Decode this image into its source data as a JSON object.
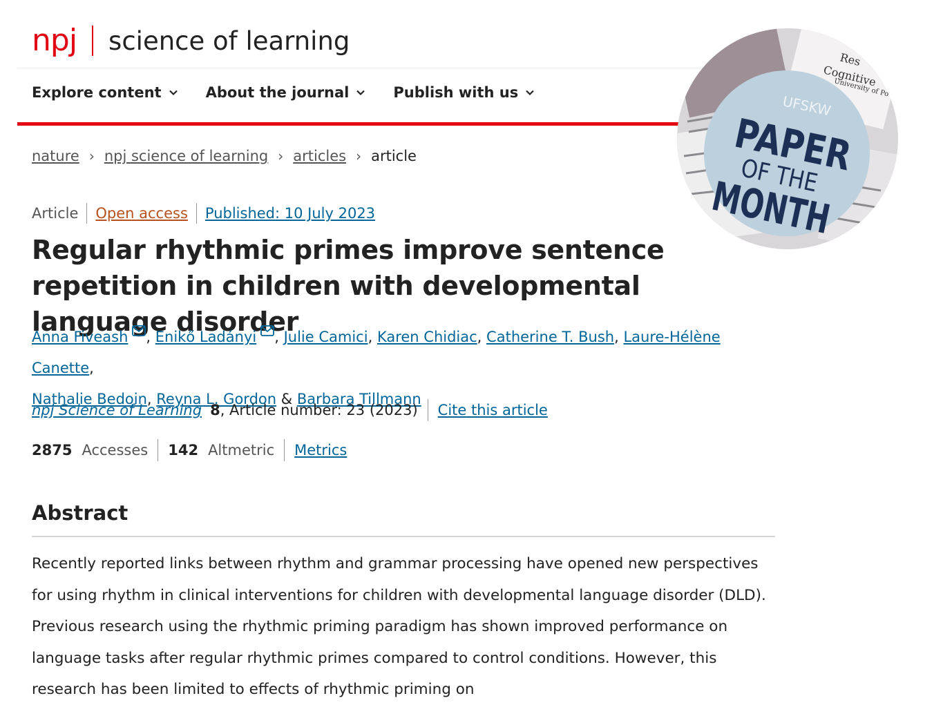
{
  "header": {
    "logo_npj": "npj",
    "logo_title": "science of learning",
    "nav": [
      {
        "label": "Explore content"
      },
      {
        "label": "About the journal"
      },
      {
        "label": "Publish with us"
      }
    ]
  },
  "breadcrumb": {
    "items": [
      "nature",
      "npj science of learning",
      "articles"
    ],
    "current": "article"
  },
  "meta": {
    "type": "Article",
    "access": "Open access",
    "published": "Published: 10 July 2023"
  },
  "article": {
    "title": "Regular rhythmic primes improve sentence repetition in children with developmental language disorder",
    "authors": [
      {
        "name": "Anna Fiveash"
      },
      {
        "name": "Enikő Ladányi"
      },
      {
        "name": "Julie Camici"
      },
      {
        "name": "Karen Chidiac"
      },
      {
        "name": "Catherine T. Bush"
      },
      {
        "name": "Laure-Hélène Canette"
      },
      {
        "name": "Nathalie Bedoin"
      },
      {
        "name": "Reyna L. Gordon"
      },
      {
        "name": "Barbara Tillmann"
      }
    ],
    "separator_comma": ",",
    "separator_amp": "&"
  },
  "citation": {
    "journal": "npj Science of Learning",
    "volume": "8",
    "article_number": ", Article number: 23 (2023)",
    "cite_link": "Cite this article"
  },
  "metrics": {
    "accesses_value": "2875",
    "accesses_label": "Accesses",
    "altmetric_value": "142",
    "altmetric_label": "Altmetric",
    "metrics_link": "Metrics"
  },
  "abstract": {
    "heading": "Abstract",
    "text": "Recently reported links between rhythm and grammar processing have opened new perspectives for using rhythm in clinical interventions for children with developmental language disorder (DLD). Previous research using the rhythmic priming paradigm has shown improved performance on language tasks after regular rhythmic primes compared to control conditions. However, this research has been limited to effects of rhythmic priming on"
  },
  "badge": {
    "org": "UFSKW",
    "line1": "PAPER",
    "line2": "OF THE",
    "line3": "MONTH",
    "bg_text1": "Res",
    "bg_text2": "Cognitive",
    "bg_text3": "University of Po",
    "colors": {
      "circle": "#bcd0dd",
      "text": "#1c2f55",
      "org": "#eef3f7"
    }
  },
  "colors": {
    "brand_red": "#e30613",
    "link": "#006699",
    "open_access": "#b7521e"
  }
}
